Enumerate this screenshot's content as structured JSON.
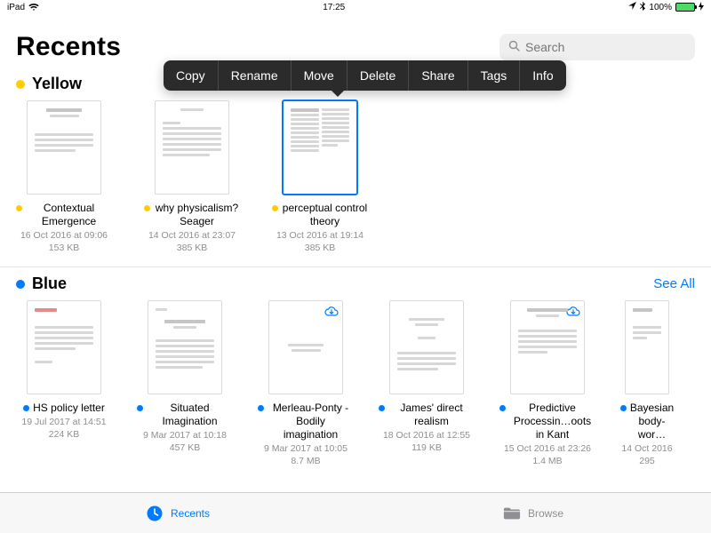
{
  "status": {
    "device": "iPad",
    "time": "17:25",
    "battery_pct": "100%"
  },
  "header": {
    "title": "Recents",
    "search_placeholder": "Search"
  },
  "popover": {
    "items": [
      "Copy",
      "Rename",
      "Move",
      "Delete",
      "Share",
      "Tags",
      "Info"
    ]
  },
  "colors": {
    "yellow": "#ffcc00",
    "blue": "#007aff"
  },
  "sections": [
    {
      "key": "yellow",
      "label": "Yellow",
      "see_all": "",
      "files": [
        {
          "name": "Contextual Emergence",
          "date": "16 Oct 2016 at 09:06",
          "size": "153 KB",
          "cloud": false,
          "selected": false
        },
        {
          "name": "why physicalism? Seager",
          "date": "14 Oct 2016 at 23:07",
          "size": "385 KB",
          "cloud": false,
          "selected": false
        },
        {
          "name": "perceptual control theory",
          "date": "13 Oct 2016 at 19:14",
          "size": "385 KB",
          "cloud": false,
          "selected": true
        }
      ]
    },
    {
      "key": "blue",
      "label": "Blue",
      "see_all": "See All",
      "files": [
        {
          "name": "HS policy letter",
          "date": "19 Jul 2017 at 14:51",
          "size": "224 KB",
          "cloud": false,
          "selected": false
        },
        {
          "name": "Situated Imagination",
          "date": "9 Mar 2017 at 10:18",
          "size": "457 KB",
          "cloud": false,
          "selected": false
        },
        {
          "name": "Merleau-Ponty - Bodily imagination",
          "date": "9 Mar 2017 at 10:05",
          "size": "8.7 MB",
          "cloud": true,
          "selected": false
        },
        {
          "name": "James' direct realism",
          "date": "18 Oct 2016 at 12:55",
          "size": "119 KB",
          "cloud": false,
          "selected": false
        },
        {
          "name": "Predictive Processin…oots in Kant",
          "date": "15 Oct 2016 at 23:26",
          "size": "1.4 MB",
          "cloud": true,
          "selected": false
        },
        {
          "name": "Bayesian body-wor…",
          "date": "14 Oct 2016",
          "size": "295",
          "cloud": false,
          "selected": false
        }
      ]
    }
  ],
  "tabs": {
    "recents": "Recents",
    "browse": "Browse"
  }
}
